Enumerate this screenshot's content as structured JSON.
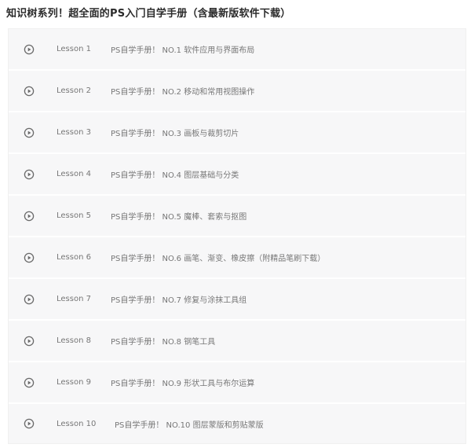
{
  "course": {
    "title": "知识树系列！超全面的PS入门自学手册（含最新版软件下载）"
  },
  "icons": {
    "play": "play-circle-icon"
  },
  "colors": {
    "row_background": "#f7f7f8",
    "text": "#777777",
    "title": "#2b2b2b"
  },
  "lessons": [
    {
      "number": "Lesson 1",
      "title": "PS自学手册！ NO.1 软件应用与界面布局"
    },
    {
      "number": "Lesson 2",
      "title": "PS自学手册！ NO.2 移动和常用视图操作"
    },
    {
      "number": "Lesson 3",
      "title": "PS自学手册！ NO.3 画板与裁剪切片"
    },
    {
      "number": "Lesson 4",
      "title": "PS自学手册！ NO.4 图层基础与分类"
    },
    {
      "number": "Lesson 5",
      "title": "PS自学手册！ NO.5 魔棒、套索与抠图"
    },
    {
      "number": "Lesson 6",
      "title": "PS自学手册！ NO.6 画笔、渐变、橡皮擦（附精品笔刷下载）"
    },
    {
      "number": "Lesson 7",
      "title": "PS自学手册！ NO.7 修复与涂抹工具组"
    },
    {
      "number": "Lesson 8",
      "title": "PS自学手册！ NO.8 钢笔工具"
    },
    {
      "number": "Lesson 9",
      "title": "PS自学手册！ NO.9 形状工具与布尔运算"
    },
    {
      "number": "Lesson 10",
      "title": "PS自学手册！ NO.10 图层蒙版和剪贴蒙版"
    }
  ]
}
